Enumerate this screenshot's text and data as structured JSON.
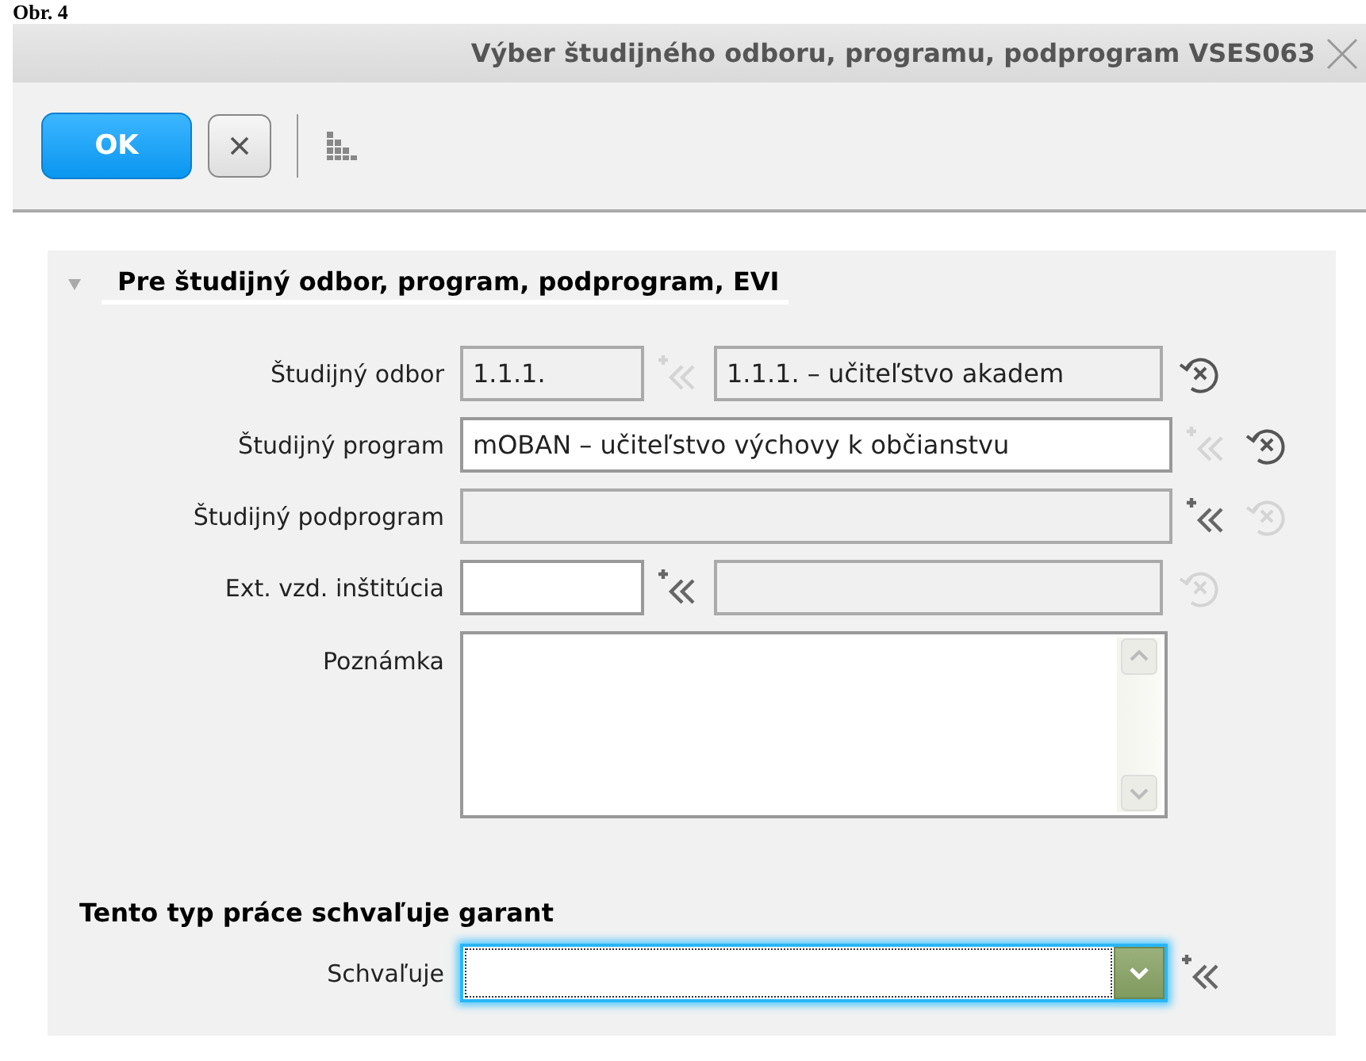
{
  "caption": "Obr. 4",
  "window": {
    "title": "Výber študijného odboru, programu, podprogram VSES063"
  },
  "toolbar": {
    "ok_label": "OK"
  },
  "section": {
    "title": "Pre študijný odbor, program, podprogram, EVI",
    "expanded": true,
    "fields": [
      {
        "kind": "pair",
        "label": "Študijný odbor",
        "code": {
          "value": "1.1.1.",
          "disabled": true
        },
        "picker_disabled": true,
        "name": {
          "value": "1.1.1. – učiteľstvo akadem",
          "disabled": true
        },
        "clear_disabled": false
      },
      {
        "kind": "single",
        "label": "Študijný program",
        "field": {
          "value": "mOBAN – učiteľstvo výchovy k občianstvu",
          "disabled": false
        },
        "picker_disabled": true,
        "clear_disabled": false
      },
      {
        "kind": "single",
        "label": "Študijný podprogram",
        "field": {
          "disabled": true
        },
        "picker_disabled": false,
        "clear_disabled": true
      },
      {
        "kind": "pair",
        "label": "Ext. vzd. inštitúcia",
        "code": {
          "disabled": false
        },
        "picker_disabled": false,
        "name": {
          "disabled": true
        },
        "clear_disabled": true
      }
    ],
    "note": {
      "label": "Poznámka"
    }
  },
  "approval": {
    "heading": "Tento typ práce schvaľuje garant",
    "label": "Schvaľuje",
    "focused": true,
    "picker_disabled": false
  }
}
